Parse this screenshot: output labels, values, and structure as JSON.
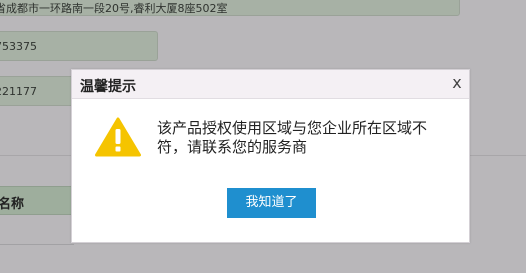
{
  "background_form": {
    "address_value": "省成都市一环路南一段20号,睿利大厦8座502室",
    "phone_value": "753375",
    "postal_code_value": "221177",
    "table_header_name": "名称"
  },
  "dialog": {
    "title": "温馨提示",
    "close_label": "x",
    "icon": "warning-triangle-icon",
    "message": "该产品授权使用区域与您企业所在区域不符，请联系您的服务商",
    "ok_button_label": "我知道了"
  },
  "colors": {
    "overlay_background": "#b9b7ba",
    "dialog_header": "#f4f0f4",
    "warning_yellow": "#f5c400",
    "button_blue": "#1f8fcf"
  }
}
